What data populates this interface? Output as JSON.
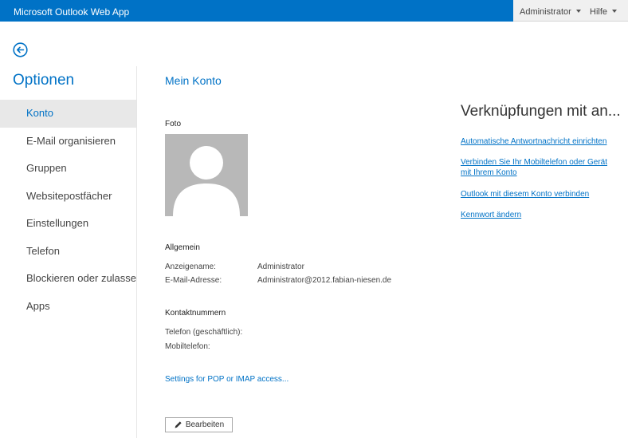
{
  "header": {
    "app_title": "Microsoft Outlook Web App",
    "user_menu": "Administrator",
    "help_menu": "Hilfe"
  },
  "sidebar": {
    "title": "Optionen",
    "items": [
      {
        "label": "Konto",
        "active": true
      },
      {
        "label": "E-Mail organisieren",
        "active": false
      },
      {
        "label": "Gruppen",
        "active": false
      },
      {
        "label": "Websitepostfächer",
        "active": false
      },
      {
        "label": "Einstellungen",
        "active": false
      },
      {
        "label": "Telefon",
        "active": false
      },
      {
        "label": "Blockieren oder zulasse",
        "active": false
      },
      {
        "label": "Apps",
        "active": false
      }
    ]
  },
  "main": {
    "title": "Mein Konto",
    "photo_label": "Foto",
    "general": {
      "heading": "Allgemein",
      "display_name_label": "Anzeigename:",
      "display_name_value": "Administrator",
      "email_label": "E-Mail-Adresse:",
      "email_value": "Administrator@2012.fabian-niesen.de"
    },
    "contact": {
      "heading": "Kontaktnummern",
      "work_phone_label": "Telefon (geschäftlich):",
      "mobile_label": "Mobiltelefon:"
    },
    "pop_imap_link": "Settings for POP or IMAP access...",
    "edit_button": "Bearbeiten"
  },
  "shortcuts": {
    "title": "Verknüpfungen mit an...",
    "links": [
      "Automatische Antwortnachricht einrichten",
      "Verbinden Sie Ihr Mobiltelefon oder Gerät mit Ihrem Konto",
      "Outlook mit diesem Konto verbinden",
      "Kennwort ändern"
    ]
  },
  "colors": {
    "accent": "#0072c6",
    "nav_active_bg": "#e8e8e8",
    "photo_bg": "#b8b8b8"
  }
}
